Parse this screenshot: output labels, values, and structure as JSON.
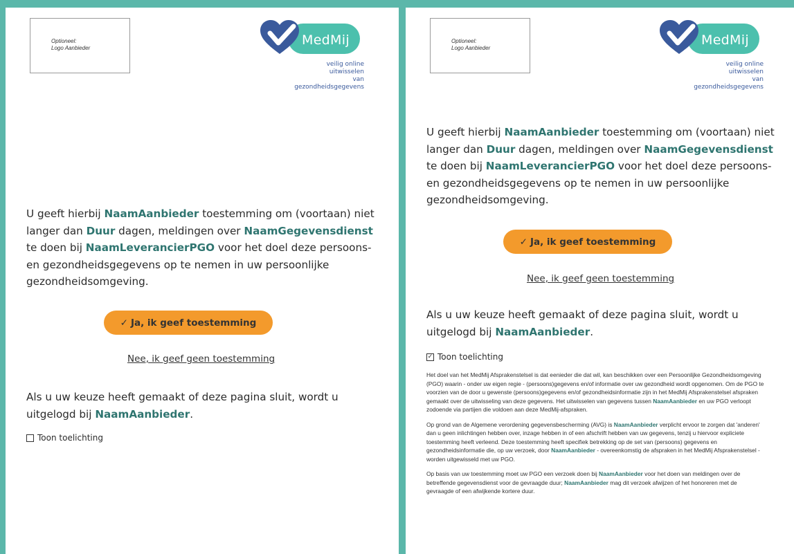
{
  "screens": [
    {
      "logo_placeholder": {
        "line1": "Optioneel:",
        "line2": "Logo Aanbieder"
      },
      "brand": {
        "name": "MedMij",
        "tagline1": "veilig online uitwisselen",
        "tagline2": "van gezondheidsgegevens"
      },
      "consent": {
        "t1": "U geeft hierbij ",
        "provider": "NaamAanbieder",
        "t2": " toestemming om (voortaan) niet langer dan ",
        "duration": "Duur",
        "t3": " dagen, meldingen over ",
        "service": "NaamGegevensdienst",
        "t4": " te doen bij ",
        "pgo": "NaamLeverancierPGO",
        "t5": " voor het doel deze persoons- en gezondheidsgegevens op te nemen in uw persoonlijke gezondheidsomgeving."
      },
      "yes_button": {
        "check": "✓",
        "label": "Ja, ik geef toestemming"
      },
      "no_link": "Nee, ik geef geen toestemming",
      "logout": {
        "t1": "Als u uw keuze heeft gemaakt of deze pagina sluit, wordt u uitgelogd bij ",
        "provider": "NaamAanbieder",
        "t2": "."
      },
      "toggle": {
        "label": "Toon toelichting",
        "checked": false,
        "mark": ""
      }
    },
    {
      "logo_placeholder": {
        "line1": "Optioneel:",
        "line2": "Logo Aanbieder"
      },
      "brand": {
        "name": "MedMij",
        "tagline1": "veilig online uitwisselen",
        "tagline2": "van gezondheidsgegevens"
      },
      "consent": {
        "t1": "U geeft hierbij ",
        "provider": "NaamAanbieder",
        "t2": " toestemming om (voortaan) niet langer dan ",
        "duration": "Duur",
        "t3": " dagen, meldingen over ",
        "service": "NaamGegevensdienst",
        "t4": " te doen bij ",
        "pgo": "NaamLeverancierPGO",
        "t5": " voor het doel deze persoons- en gezondheidsgegevens op te nemen in uw persoonlijke gezondheidsomgeving."
      },
      "yes_button": {
        "check": "✓",
        "label": "Ja, ik geef toestemming"
      },
      "no_link": "Nee, ik geef geen toestemming",
      "logout": {
        "t1": "Als u uw keuze heeft gemaakt of deze pagina sluit, wordt u uitgelogd bij ",
        "provider": "NaamAanbieder",
        "t2": "."
      },
      "toggle": {
        "label": "Toon toelichting",
        "checked": true,
        "mark": "✓"
      },
      "explanation": {
        "p1a": "Het doel van het MedMij Afsprakenstelsel is dat eenieder die dat wil, kan beschikken over een Persoonlijke Gezondheidsomgeving (PGO) waarin - onder uw eigen regie - (persoons)gegevens en/of informatie over uw gezondheid wordt opgenomen. Om de PGO te voorzien van de door u gewenste (persoons)gegevens en/of gezondheidsinformatie zijn in het MedMij Afsprakenstelsel afspraken gemaakt over de uitwisseling van deze gegevens. Het uitwisselen van gegevens tussen ",
        "p1_provider": "NaamAanbieder",
        "p1b": " en uw PGO verloopt zodoende via partijen die voldoen aan deze MedMij-afspraken.",
        "p2a": "Op grond van de Algemene verordening gegevensbescherming (AVG) is ",
        "p2_provider1": "NaamAanbieder",
        "p2b": " verplicht ervoor te zorgen dat 'anderen' dan u geen inlichtingen hebben over, inzage hebben in of een afschrift hebben van uw gegevens, tenzij u hiervoor expliciete toestemming heeft verleend. Deze toestemming heeft specifiek betrekking op de set van (persoons) gegevens en gezondheidsinformatie die, op uw verzoek, door ",
        "p2_provider2": "NaamAanbieder",
        "p2c": " - overeenkomstig de afspraken in het MedMij Afsprakenstelsel - worden uitgewisseld met uw PGO.",
        "p3a": "Op basis van uw toestemming moet uw PGO een verzoek doen bij ",
        "p3_provider1": "NaamAanbieder",
        "p3b": " voor het doen van meldingen over de betreffende gegevensdienst voor de gevraagde duur; ",
        "p3_provider2": "NaamAanbieder",
        "p3c": " mag dit verzoek afwijzen of het honoreren met de gevraagde of een afwijkende kortere duur."
      }
    }
  ],
  "colors": {
    "background": "#5bb7aa",
    "accent_button": "#f39a2c",
    "highlight": "#2f7570",
    "brand_blue": "#3a5a9c",
    "brand_teal": "#4cc0ad"
  }
}
